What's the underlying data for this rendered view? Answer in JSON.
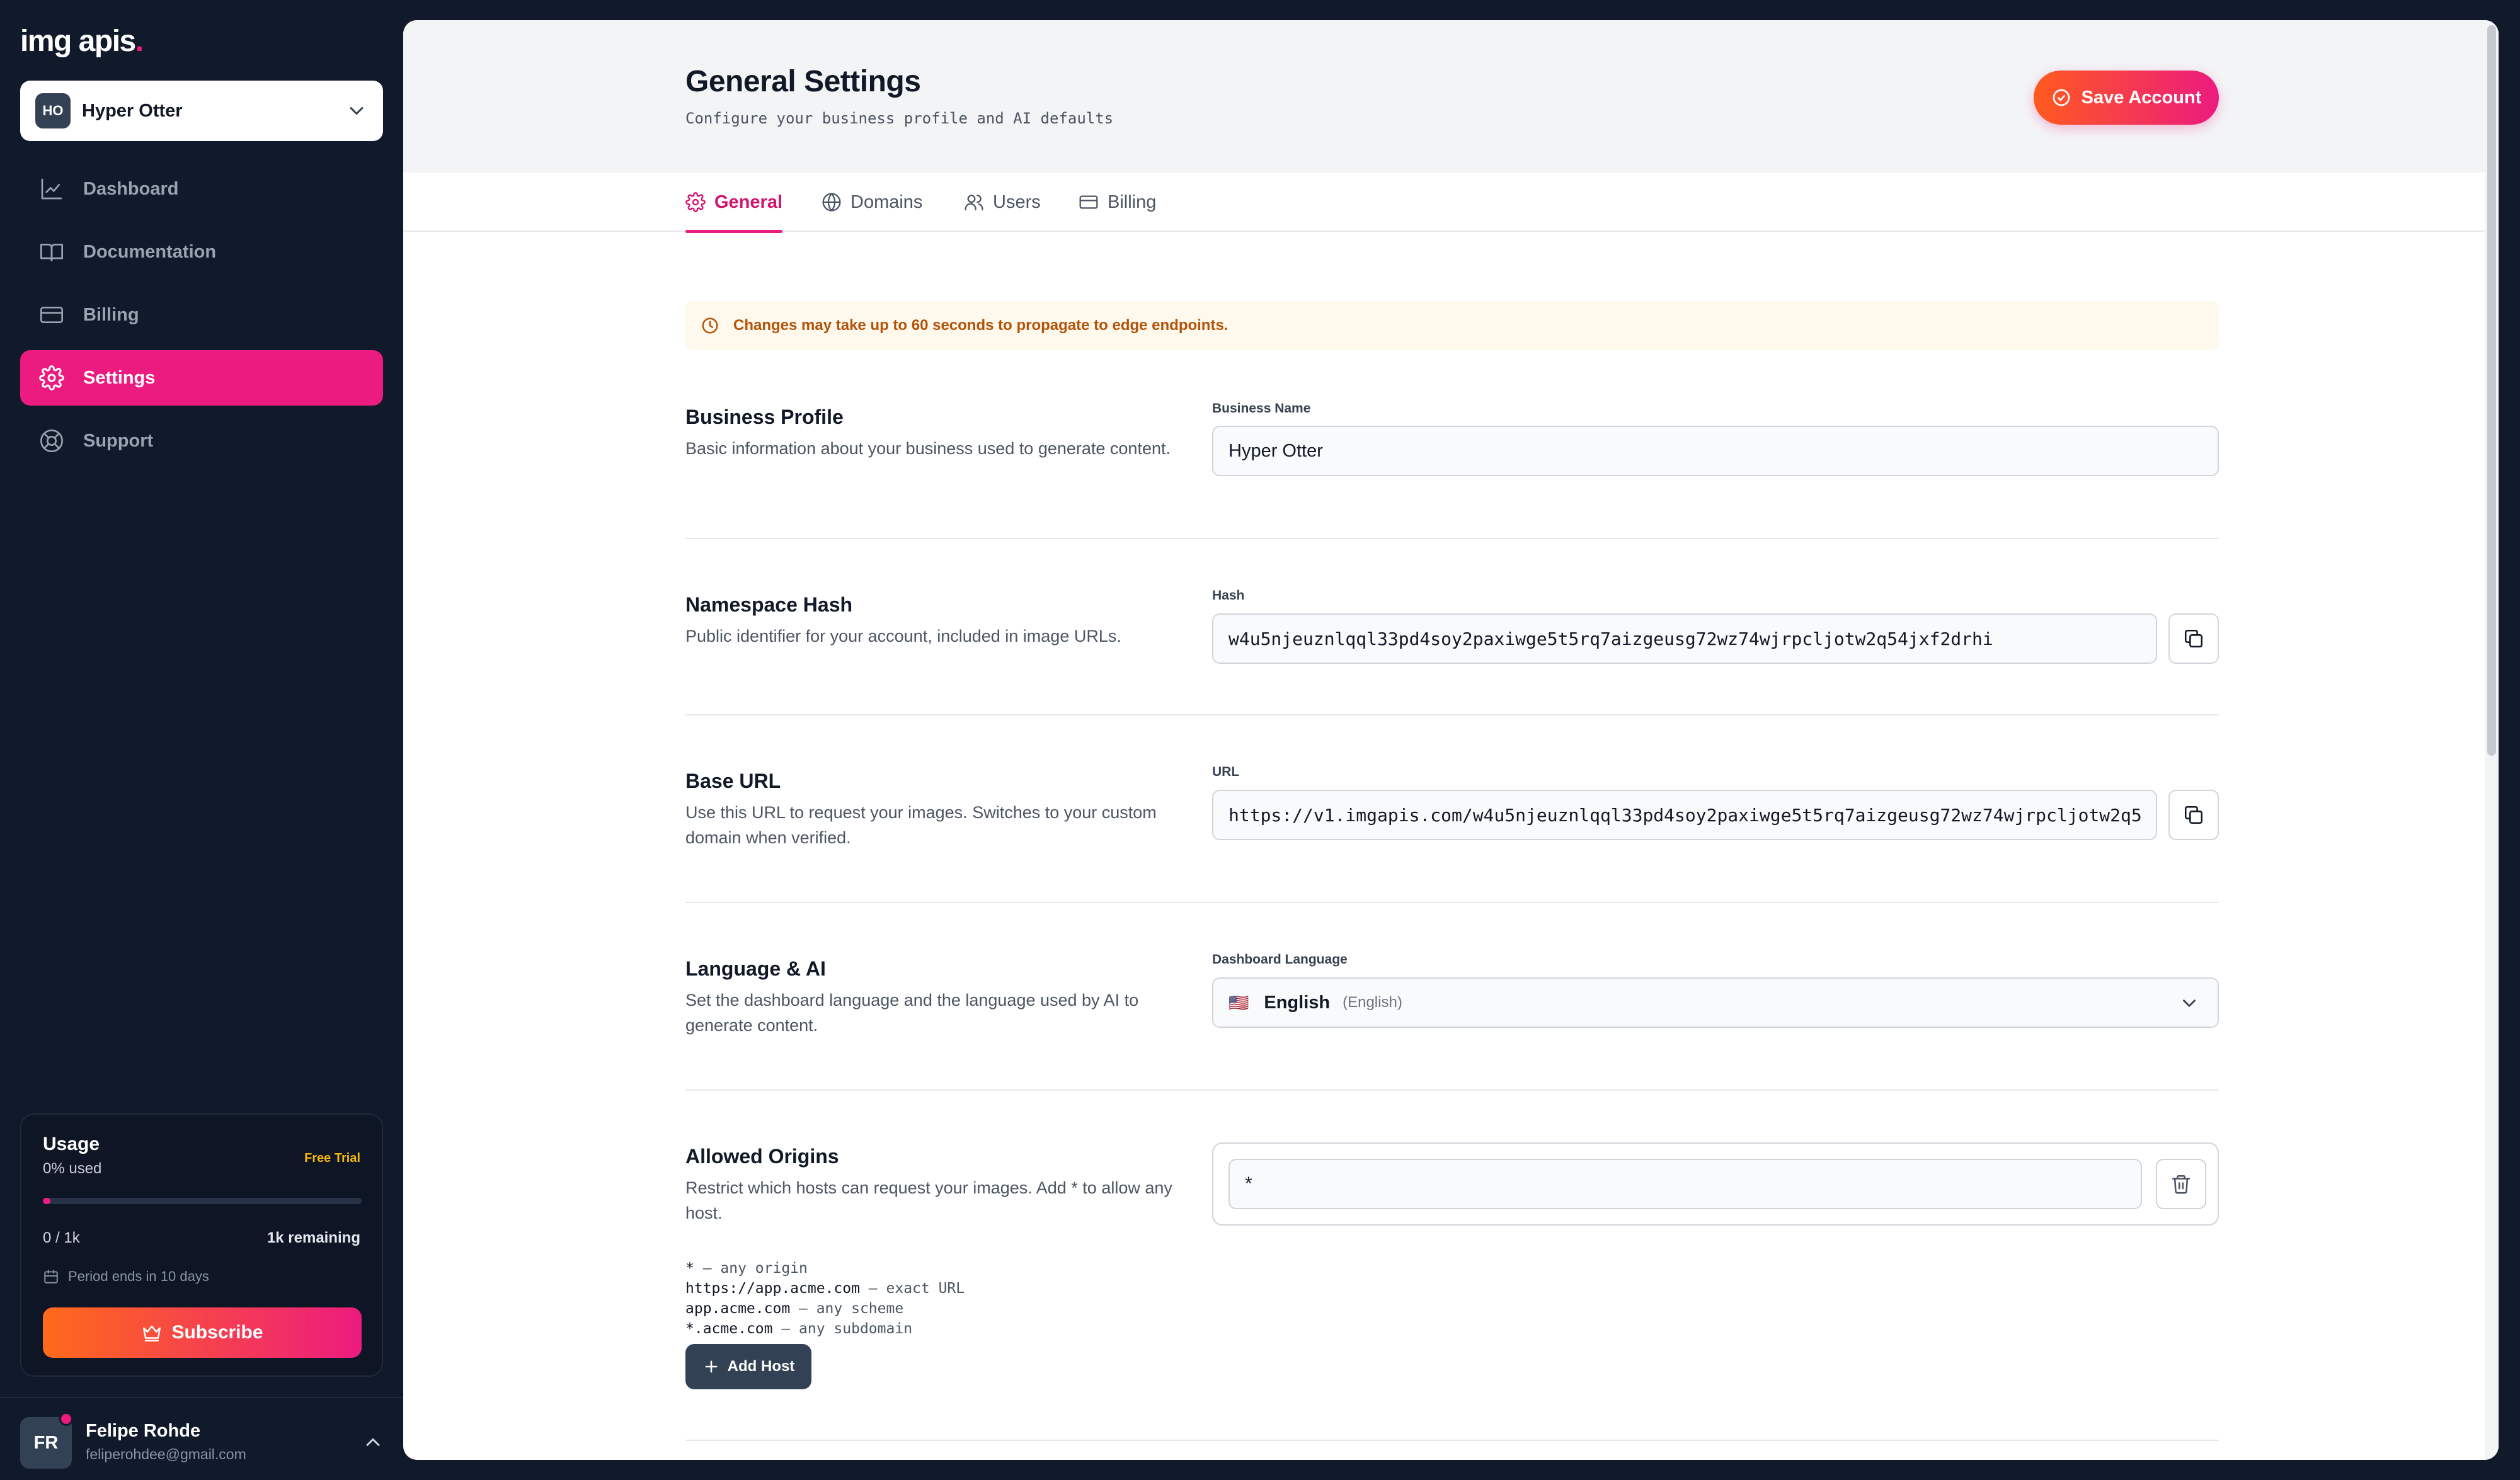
{
  "brand": {
    "name": "img apis",
    "dot": "."
  },
  "workspace": {
    "initials": "HO",
    "name": "Hyper Otter"
  },
  "nav": [
    {
      "label": "Dashboard"
    },
    {
      "label": "Documentation"
    },
    {
      "label": "Billing"
    },
    {
      "label": "Settings",
      "active": true
    },
    {
      "label": "Support"
    }
  ],
  "usage": {
    "title": "Usage",
    "percent_text": "0% used",
    "plan_badge": "Free Trial",
    "progress": 0,
    "count": "0 / 1k",
    "remaining": "1k remaining",
    "period": "Period ends in 10 days",
    "subscribe_label": "Subscribe"
  },
  "user": {
    "initials": "FR",
    "name": "Felipe Rohde",
    "email": "feliperohdee@gmail.com"
  },
  "header": {
    "title": "General Settings",
    "subtitle": "Configure your business profile and AI defaults",
    "save_label": "Save Account"
  },
  "tabs": [
    {
      "label": "General",
      "active": true
    },
    {
      "label": "Domains"
    },
    {
      "label": "Users"
    },
    {
      "label": "Billing"
    }
  ],
  "notice": "Changes may take up to 60 seconds to propagate to edge endpoints.",
  "sections": {
    "business": {
      "title": "Business Profile",
      "description": "Basic information about your business used to generate content.",
      "field_label": "Business Name",
      "value": "Hyper Otter"
    },
    "namespace": {
      "title": "Namespace Hash",
      "description": "Public identifier for your account, included in image URLs.",
      "field_label": "Hash",
      "value": "w4u5njeuznlqql33pd4soy2paxiwge5t5rq7aizgeusg72wz74wjrpcljotw2q54jxf2drhi"
    },
    "base_url": {
      "title": "Base URL",
      "description": "Use this URL to request your images. Switches to your custom domain when verified.",
      "field_label": "URL",
      "value": "https://v1.imgapis.com/w4u5njeuznlqql33pd4soy2paxiwge5t5rq7aizgeusg72wz74wjrpcljotw2q5"
    },
    "language": {
      "title": "Language & AI",
      "description": "Set the dashboard language and the language used by AI to generate content.",
      "field_label": "Dashboard Language",
      "flag": "🇺🇸",
      "value": "English",
      "native": "(English)"
    },
    "origins": {
      "title": "Allowed Origins",
      "description": "Restrict which hosts can request your images. Add * to allow any host.",
      "origin_value": "*",
      "examples": [
        {
          "pattern": "*",
          "hint": " — any origin"
        },
        {
          "pattern": "https://app.acme.com",
          "hint": " — exact URL"
        },
        {
          "pattern": "app.acme.com",
          "hint": " — any scheme"
        },
        {
          "pattern": "*.acme.com",
          "hint": " — any subdomain"
        }
      ],
      "add_label": "Add Host"
    }
  },
  "colors": {
    "accent": "#ec1b7f",
    "sidebar_bg": "#111a2b",
    "warning": "#b45309"
  }
}
